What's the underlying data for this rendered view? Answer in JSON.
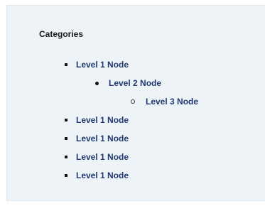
{
  "categories": {
    "title": "Categories",
    "items": [
      {
        "label": "Level 1 Node",
        "level": 1
      },
      {
        "label": "Level 2 Node",
        "level": 2
      },
      {
        "label": "Level 3 Node",
        "level": 3
      },
      {
        "label": "Level 1 Node",
        "level": 1
      },
      {
        "label": "Level 1 Node",
        "level": 1
      },
      {
        "label": "Level 1 Node",
        "level": 1
      },
      {
        "label": "Level 1 Node",
        "level": 1
      }
    ]
  },
  "colors": {
    "panel_background": "#eef3f7",
    "link": "#1f3a72",
    "heading": "#1a1a1a"
  },
  "icons": {
    "level1": "square-bullet-icon",
    "level2": "disc-bullet-icon",
    "level3": "circle-bullet-icon"
  }
}
